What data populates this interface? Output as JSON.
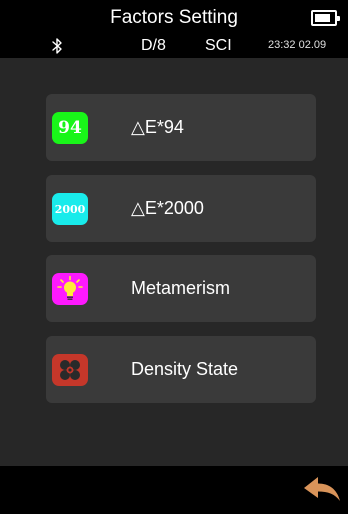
{
  "header": {
    "title": "Factors Setting",
    "battery_level": 0.85
  },
  "status": {
    "bluetooth_icon": "bluetooth-icon",
    "geometry": "D/8",
    "mode": "SCI",
    "time": "23:32",
    "date": "02.09"
  },
  "menu": {
    "items": [
      {
        "badge": "94",
        "label": "△E*94",
        "color": "#19f519",
        "icon": "de94-icon"
      },
      {
        "badge": "2000",
        "label": "△E*2000",
        "color": "#19ebeb",
        "icon": "de2000-icon"
      },
      {
        "badge": "",
        "label": "Metamerism",
        "color": "#ff19ff",
        "icon": "bulb-icon"
      },
      {
        "badge": "",
        "label": "Density State",
        "color": "#c5372a",
        "icon": "fan-icon"
      }
    ]
  },
  "footer": {
    "back_icon": "back-arrow-icon",
    "back_color": "#d9945a"
  }
}
